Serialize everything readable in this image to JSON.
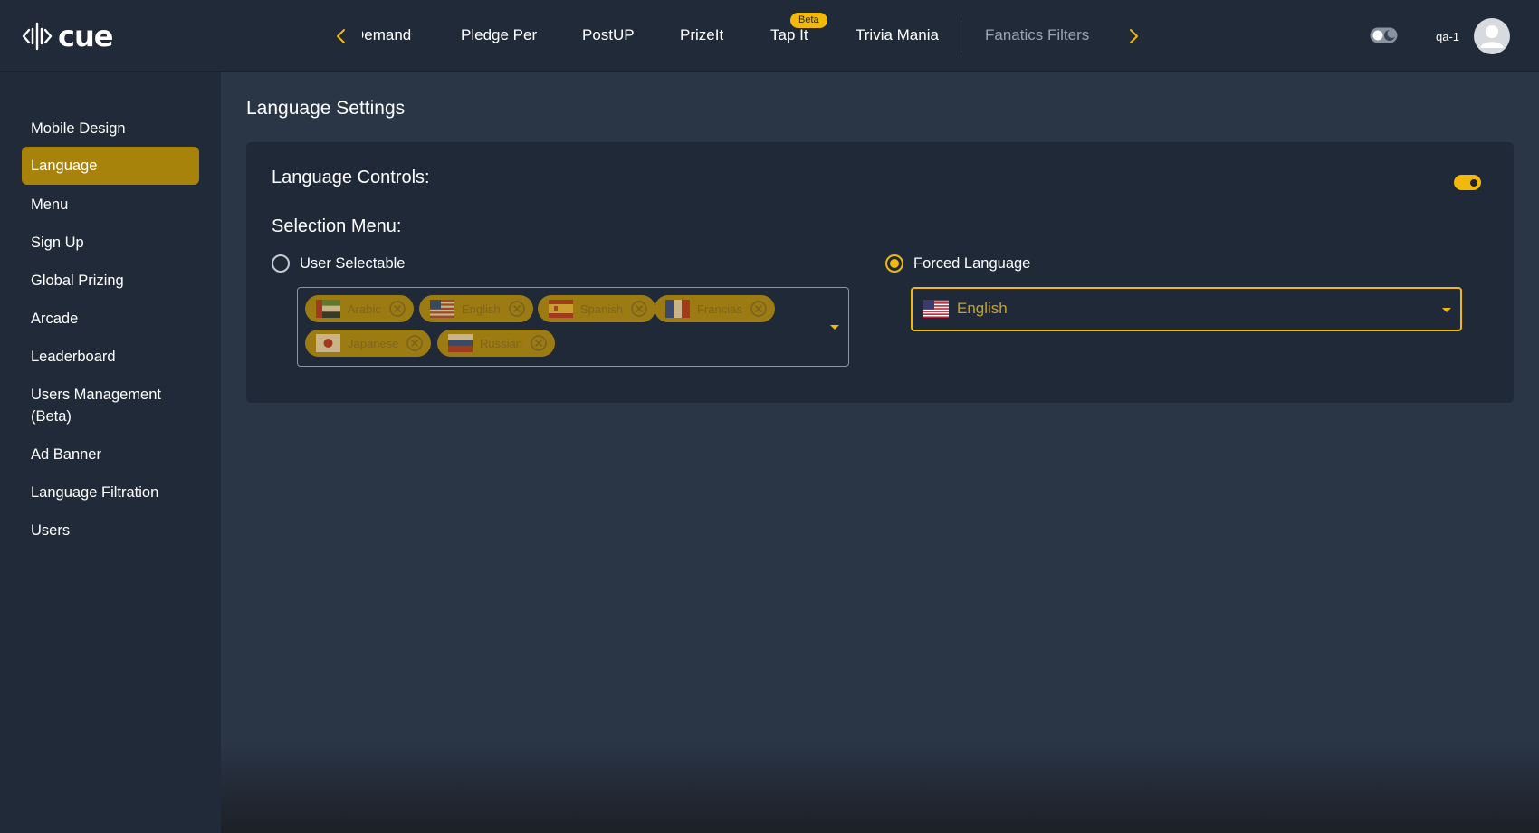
{
  "app": {
    "logo_text": "cue"
  },
  "nav": {
    "items": [
      {
        "label": "Demand"
      },
      {
        "label": "Pledge Per"
      },
      {
        "label": "PostUP"
      },
      {
        "label": "PrizeIt"
      },
      {
        "label": "Tap It",
        "badge": "Beta"
      },
      {
        "label": "Trivia Mania"
      },
      {
        "label": "Fanatics Filters"
      }
    ]
  },
  "user": {
    "name": "qa-1"
  },
  "sidebar": {
    "items": [
      {
        "label": "Mobile Design"
      },
      {
        "label": "Language"
      },
      {
        "label": "Menu"
      },
      {
        "label": "Sign Up"
      },
      {
        "label": "Global Prizing"
      },
      {
        "label": "Arcade"
      },
      {
        "label": "Leaderboard"
      },
      {
        "label": "Users Management (Beta)"
      },
      {
        "label": "Ad Banner"
      },
      {
        "label": "Language Filtration"
      },
      {
        "label": "Users"
      }
    ],
    "active_index": 1
  },
  "page": {
    "title": "Language Settings",
    "controls_title": "Language Controls:",
    "controls_enabled": true,
    "selection_title": "Selection Menu:",
    "options": {
      "user_selectable": {
        "label": "User Selectable",
        "checked": false
      },
      "forced_language": {
        "label": "Forced Language",
        "checked": true
      }
    },
    "user_selectable_languages": [
      {
        "label": "Arabic",
        "flag": "uae-flag"
      },
      {
        "label": "English",
        "flag": "us-flag"
      },
      {
        "label": "Spanish",
        "flag": "spain-flag"
      },
      {
        "label": "Francias",
        "flag": "france-flag"
      },
      {
        "label": "Japanese",
        "flag": "japan-flag"
      },
      {
        "label": "Russian",
        "flag": "russia-flag"
      }
    ],
    "forced_language_value": {
      "label": "English",
      "flag": "us-flag"
    }
  },
  "colors": {
    "accent": "#f2b90c",
    "active_nav_bg": "#a7830c",
    "chip_bg": "#9c7c12",
    "topbar_bg": "#212a38",
    "content_bg": "#2a3546",
    "card_bg": "#202938"
  }
}
